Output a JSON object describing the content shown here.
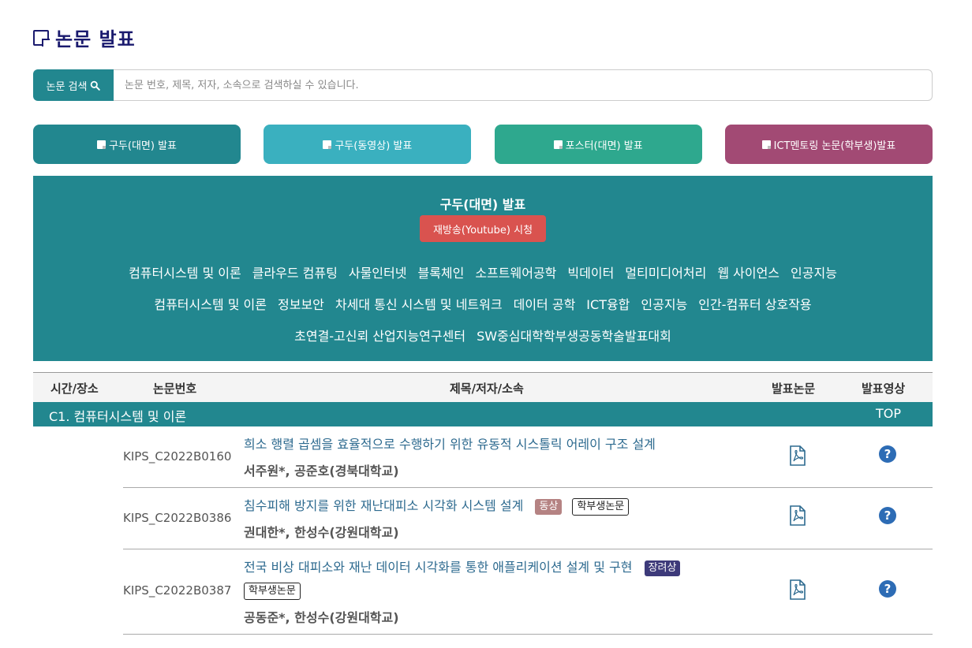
{
  "header": {
    "title": "논문 발표"
  },
  "search": {
    "label": "논문 검색",
    "placeholder": "논문 번호, 제목, 저자, 소속으로 검색하실 수 있습니다."
  },
  "categories": [
    {
      "label": "구두(대면) 발표",
      "color": "#22878f"
    },
    {
      "label": "구두(동영상) 발표",
      "color": "#3ab0bf"
    },
    {
      "label": "포스터(대면) 발표",
      "color": "#2ea88e"
    },
    {
      "label": "ICT멘토링 논문(학부생)발표",
      "color": "#a24a74"
    }
  ],
  "panel": {
    "title": "구두(대면) 발표",
    "replay_label": "재방송(Youtube) 시청",
    "sessions": [
      "컴퓨터시스템 및 이론",
      "클라우드 컴퓨팅",
      "사물인터넷",
      "블록체인",
      "소프트웨어공학",
      "빅데이터",
      "멀티미디어처리",
      "웹 사이언스",
      "인공지능",
      "컴퓨터시스템 및 이론",
      "정보보안",
      "차세대 통신 시스템 및 네트워크",
      "데이터 공학",
      "ICT융합",
      "인공지능",
      "인간-컴퓨터 상호작용",
      "초연결-고신뢰 산업지능연구센터",
      "SW중심대학학부생공동학술발표대회"
    ]
  },
  "table": {
    "headers": {
      "time": "시간/장소",
      "id": "논문번호",
      "title": "제목/저자/소속",
      "paper": "발표논문",
      "video": "발표영상"
    },
    "section": {
      "title": "C1. 컴퓨터시스템 및 이론",
      "top_label": "TOP"
    },
    "rows": [
      {
        "id": "KIPS_C2022B0160",
        "title": "희소 행렬 곱셈을 효율적으로 수행하기 위한 유동적 시스톨릭 어레이 구조 설계",
        "authors": "서주원*, 공준호(경북대학교)"
      },
      {
        "id": "KIPS_C2022B0386",
        "title": "침수피해 방지를 위한 재난대피소 시각화 시스템 설계",
        "badge_video": "동상",
        "badge_student": "학부생논문",
        "authors": "권대한*, 한성수(강원대학교)"
      },
      {
        "id": "KIPS_C2022B0387",
        "title": "전국 비상 대피소와 재난 데이터 시각화를 통한 애플리케이션 설계 및 구현",
        "badge_award": "장려상",
        "badge_student": "학부생논문",
        "authors": "공동준*, 한성수(강원대학교)"
      }
    ]
  },
  "icons": {
    "title": "note-icon",
    "search": "search-icon",
    "pdf": "pdf-icon",
    "help": "question-circle-icon"
  }
}
